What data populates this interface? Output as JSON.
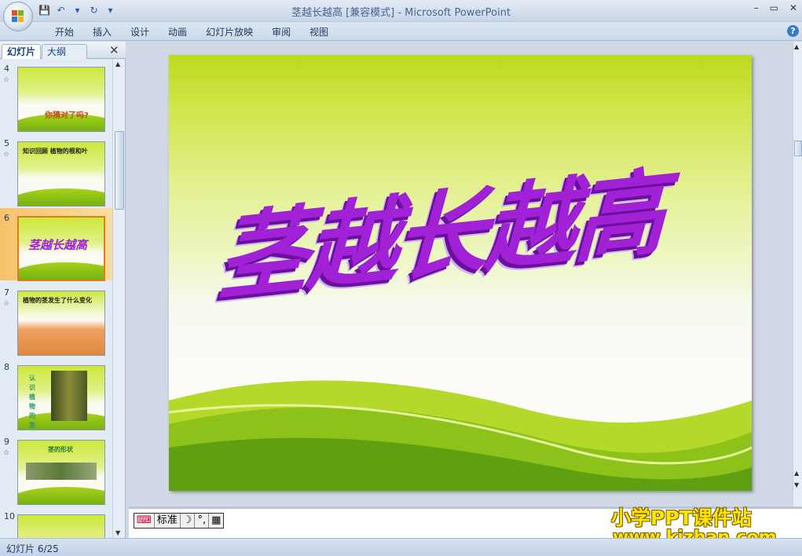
{
  "window": {
    "title": "茎越长越高 [兼容模式] - Microsoft PowerPoint",
    "controls": [
      "–",
      "▭",
      "✕"
    ]
  },
  "qat": {
    "save": "💾",
    "undo": "↶",
    "undo_dd": "▾",
    "redo": "↻",
    "customize": "▾"
  },
  "ribbon": {
    "tabs": [
      "开始",
      "插入",
      "设计",
      "动画",
      "幻灯片放映",
      "审阅",
      "视图"
    ],
    "help": "?"
  },
  "panel": {
    "tab_slides": "幻灯片",
    "tab_outline": "大纲",
    "close": "✕",
    "thumbnails": [
      {
        "num": "4",
        "anim": "☆",
        "title": "你猜对了吗?",
        "selected": false
      },
      {
        "num": "5",
        "anim": "☆",
        "title": "知识回顾  植物的根和叶",
        "selected": false
      },
      {
        "num": "6",
        "anim": "",
        "title": "茎越长越高",
        "selected": true
      },
      {
        "num": "7",
        "anim": "☆",
        "title": "植物的茎发生了什么变化",
        "selected": false
      },
      {
        "num": "8",
        "anim": "",
        "title": "认识植物的茎",
        "selected": false
      },
      {
        "num": "9",
        "anim": "☆",
        "title": "茎的形状",
        "selected": false
      },
      {
        "num": "10",
        "anim": "",
        "title": "",
        "selected": false
      }
    ]
  },
  "slide": {
    "title": "茎越长越高"
  },
  "ime": {
    "logo": "⌨",
    "mode": "标准",
    "moon": "☽",
    "punct": "°,",
    "kbd": "▦"
  },
  "watermark": {
    "line1": "小学PPT课件站",
    "line2": "www.kjzhan.com"
  },
  "status": {
    "slide_counter": "幻灯片 6/25"
  }
}
